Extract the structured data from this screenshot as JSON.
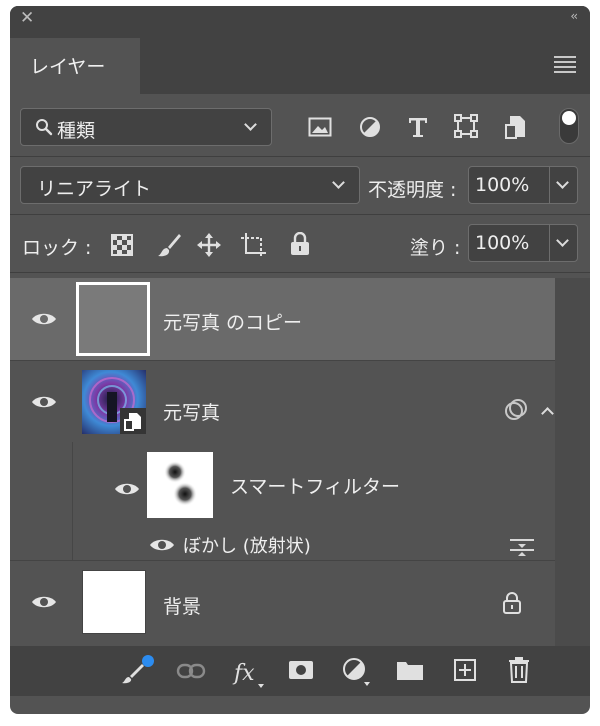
{
  "panel": {
    "tab_label": "レイヤー",
    "collapse_glyph": "‹‹",
    "close_glyph": "✕"
  },
  "filter": {
    "kind_label": "種類",
    "kind_icons": [
      "image-filter-icon",
      "adjustment-filter-icon",
      "type-filter-icon",
      "shape-filter-icon",
      "smart-object-filter-icon"
    ]
  },
  "blend": {
    "mode": "リニアライト",
    "opacity_label": "不透明度 :",
    "opacity_value": "100%"
  },
  "lock": {
    "label": "ロック :",
    "fill_label": "塗り :",
    "fill_value": "100%"
  },
  "layers": [
    {
      "name": "元写真 のコピー",
      "selected": true,
      "visible": true
    },
    {
      "name": "元写真",
      "visible": true,
      "smart_object": true,
      "expanded": true,
      "smart_filters": {
        "label": "スマートフィルター",
        "items": [
          {
            "name": "ぼかし (放射状)"
          }
        ]
      }
    },
    {
      "name": "背景",
      "visible": true,
      "locked": true
    }
  ],
  "colors": {
    "panel_bg": "#535353",
    "header_bg": "#424242",
    "selected_row": "#6a6a6a",
    "badge_blue": "#2c8cf0"
  }
}
